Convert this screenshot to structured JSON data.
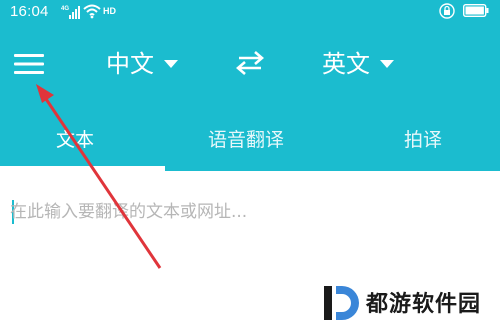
{
  "status_bar": {
    "time": "16:04",
    "network": "4G",
    "hd": "HD"
  },
  "header": {
    "source_language": "中文",
    "target_language": "英文"
  },
  "tabs": [
    {
      "label": "文本",
      "active": true
    },
    {
      "label": "语音翻译",
      "active": false
    },
    {
      "label": "拍译",
      "active": false
    }
  ],
  "input": {
    "placeholder": "在此输入要翻译的文本或网址...",
    "value": ""
  },
  "watermark": {
    "text": "都游软件园"
  },
  "colors": {
    "header_bg": "#1bbccf",
    "annotation_arrow": "#e0353b",
    "text_on_header": "#ffffff",
    "placeholder": "#b6b6b6"
  },
  "icons": {
    "menu": "hamburger-menu-icon",
    "swap": "swap-arrows-icon",
    "dropdown": "caret-down-icon"
  }
}
